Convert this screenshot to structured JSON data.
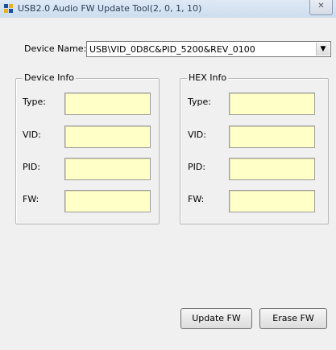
{
  "window": {
    "title": "USB2.0 Audio FW Update Tool(2, 0, 1, 10)",
    "close_glyph": "✕",
    "icon": "usb-app-icon"
  },
  "device": {
    "label": "Device Name:",
    "selected": "USB\\VID_0D8C&PID_5200&REV_0100",
    "arrow_glyph": "▼"
  },
  "device_info": {
    "title": "Device Info",
    "fields": [
      {
        "label": "Type:",
        "value": ""
      },
      {
        "label": "VID:",
        "value": ""
      },
      {
        "label": "PID:",
        "value": ""
      },
      {
        "label": "FW:",
        "value": ""
      }
    ]
  },
  "hex_info": {
    "title": "HEX Info",
    "fields": [
      {
        "label": "Type:",
        "value": ""
      },
      {
        "label": "VID:",
        "value": ""
      },
      {
        "label": "PID:",
        "value": ""
      },
      {
        "label": "FW:",
        "value": ""
      }
    ]
  },
  "buttons": {
    "update": "Update FW",
    "erase": "Erase FW"
  },
  "colors": {
    "field_bg": "#ffffc8",
    "window_bg": "#f0f0f0"
  }
}
